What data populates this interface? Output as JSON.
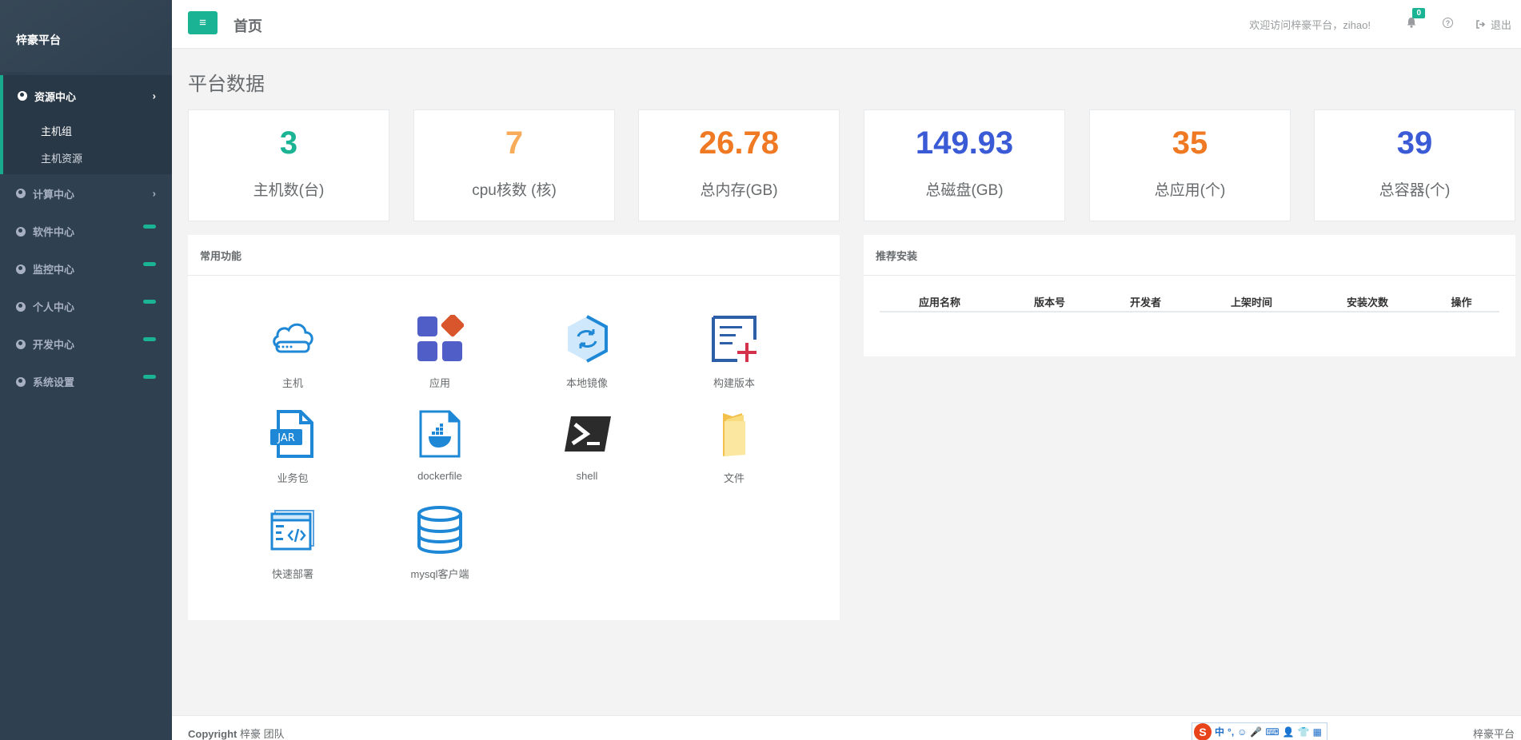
{
  "brand": "梓豪平台",
  "nav": {
    "active": {
      "label": "资源中心",
      "chevron": "›",
      "children": [
        "主机组",
        "主机资源"
      ]
    },
    "items": [
      {
        "label": "计算中心",
        "marker": "chevron",
        "chevron": "›"
      },
      {
        "label": "软件中心",
        "marker": "pill"
      },
      {
        "label": "监控中心",
        "marker": "pill"
      },
      {
        "label": "个人中心",
        "marker": "pill"
      },
      {
        "label": "开发中心",
        "marker": "pill"
      },
      {
        "label": "系统设置",
        "marker": "pill"
      }
    ]
  },
  "topbar": {
    "menu_icon": "≡",
    "title": "首页",
    "welcome": "欢迎访问梓豪平台，zihao!",
    "badge": "0",
    "help": "?",
    "logout": "退出"
  },
  "section_title": "平台数据",
  "stats": [
    {
      "value": "3",
      "label": "主机数(台)",
      "color": "#1ab394"
    },
    {
      "value": "7",
      "label": "cpu核数 (核)",
      "color": "#f8ac59"
    },
    {
      "value": "26.78",
      "label": "总内存(GB)",
      "color": "#f07a23"
    },
    {
      "value": "149.93",
      "label": "总磁盘(GB)",
      "color": "#3b5bd6"
    },
    {
      "value": "35",
      "label": "总应用(个)",
      "color": "#f07a23"
    },
    {
      "value": "39",
      "label": "总容器(个)",
      "color": "#3b5bd6"
    }
  ],
  "functions_panel": {
    "title": "常用功能",
    "items": [
      {
        "label": "主机",
        "icon": "cloud-server-icon"
      },
      {
        "label": "应用",
        "icon": "apps-grid-icon"
      },
      {
        "label": "本地镜像",
        "icon": "image-sync-icon"
      },
      {
        "label": "构建版本",
        "icon": "build-version-icon"
      },
      {
        "label": "业务包",
        "icon": "jar-file-icon"
      },
      {
        "label": "dockerfile",
        "icon": "docker-file-icon"
      },
      {
        "label": "shell",
        "icon": "terminal-icon"
      },
      {
        "label": "文件",
        "icon": "folder-icon"
      },
      {
        "label": "快速部署",
        "icon": "code-window-icon"
      },
      {
        "label": "mysql客户端",
        "icon": "database-icon"
      }
    ]
  },
  "recommend_panel": {
    "title": "推荐安装",
    "columns": [
      "应用名称",
      "版本号",
      "开发者",
      "上架时间",
      "安装次数",
      "操作"
    ]
  },
  "footer": {
    "copyright_prefix": "Copyright",
    "copyright_text": " 梓豪 团队",
    "ime": [
      "S",
      "中",
      "°,",
      "☺",
      "🎤",
      "⌨",
      "👤",
      "👕",
      "▦"
    ],
    "right": "梓豪平台"
  }
}
